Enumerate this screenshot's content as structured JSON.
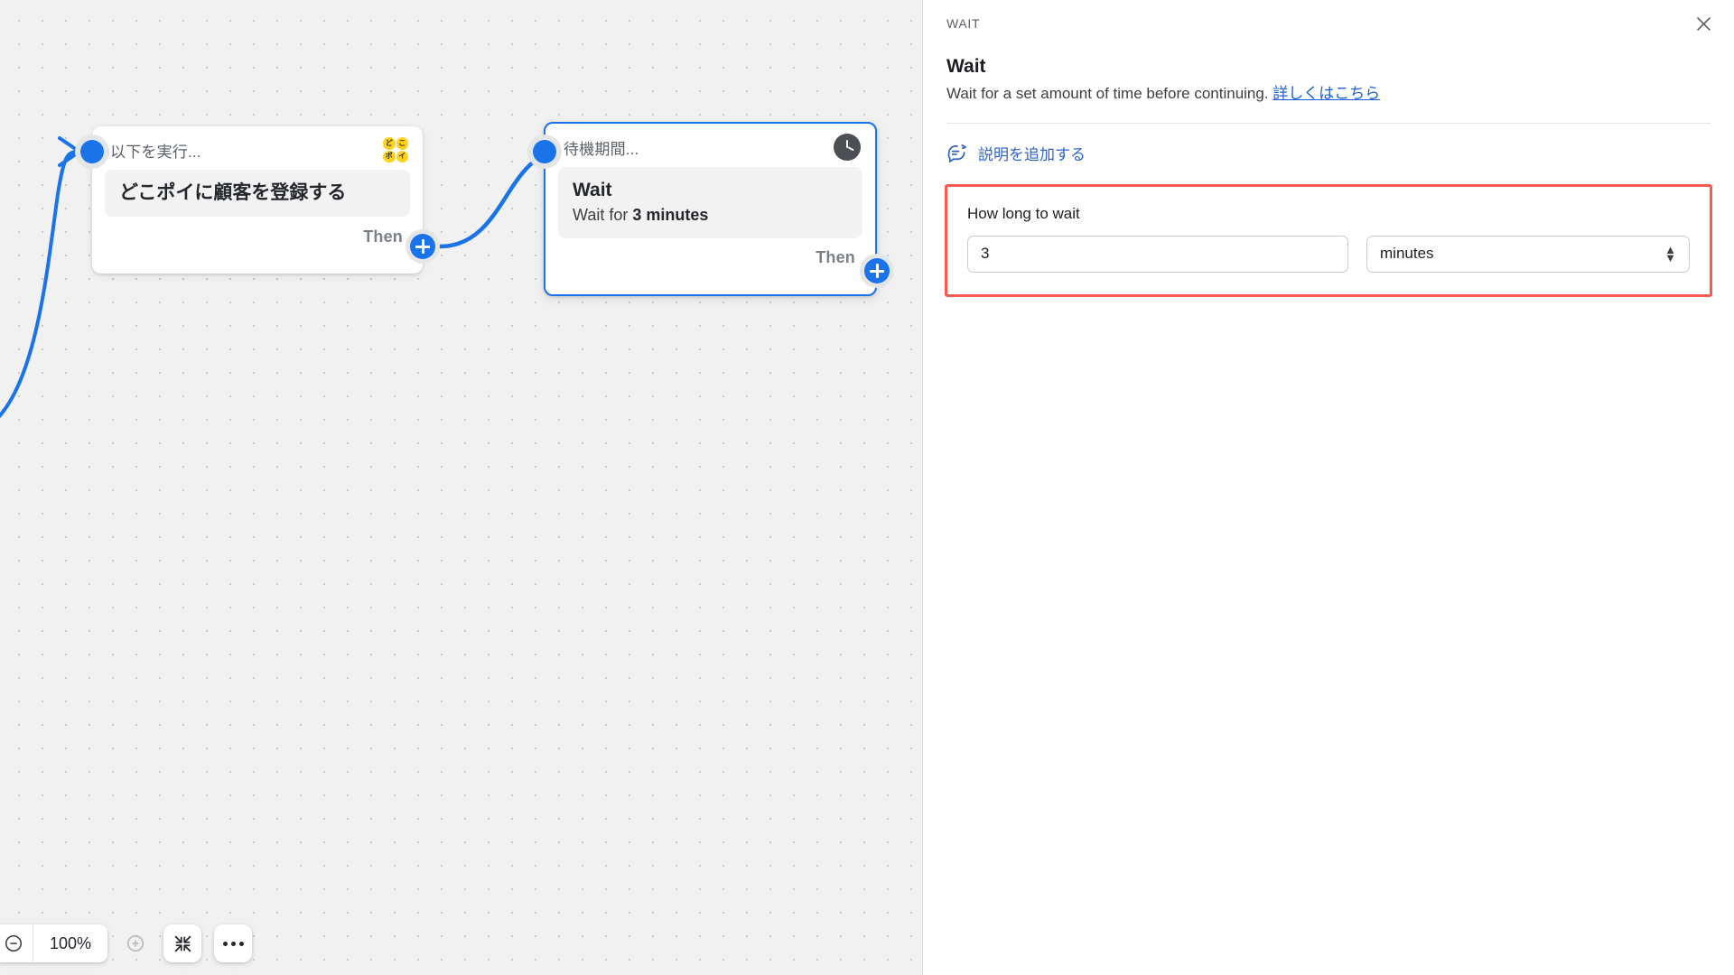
{
  "canvas": {
    "nodes": [
      {
        "id": "action-node",
        "header_title": "以下を実行...",
        "app_icon": "dokopoi-logo-icon",
        "app_icon_letters": [
          "ど",
          "こ",
          "ポ",
          "イ"
        ],
        "body_main": "どこポイに顧客を登録する",
        "footer_label": "Then"
      },
      {
        "id": "wait-node",
        "header_title": "待機期間...",
        "app_icon": "clock-icon",
        "body_main": "Wait",
        "body_sub_prefix": "Wait for ",
        "body_sub_strong": "3 minutes",
        "footer_label": "Then"
      }
    ]
  },
  "toolbar": {
    "zoom_out_label": "zoom-out",
    "zoom_value": "100%",
    "zoom_in_label": "zoom-in",
    "fit_label": "fit-to-screen",
    "more_label": "more-options"
  },
  "panel": {
    "eyebrow": "WAIT",
    "title": "Wait",
    "description": "Wait for a set amount of time before continuing.",
    "description_link": "詳しくはこちら",
    "close_label": "✕",
    "add_description_label": "説明を追加する",
    "form": {
      "label": "How long to wait",
      "amount_value": "3",
      "amount_placeholder": "",
      "unit_value": "minutes",
      "highlight_color": "#fc5a50"
    }
  },
  "colors": {
    "accent": "#1a73e8",
    "link": "#1a5fd6",
    "highlight": "#fc5a50",
    "logo_yellow": "#ffd21e",
    "canvas_bg": "#f1f1f1"
  }
}
